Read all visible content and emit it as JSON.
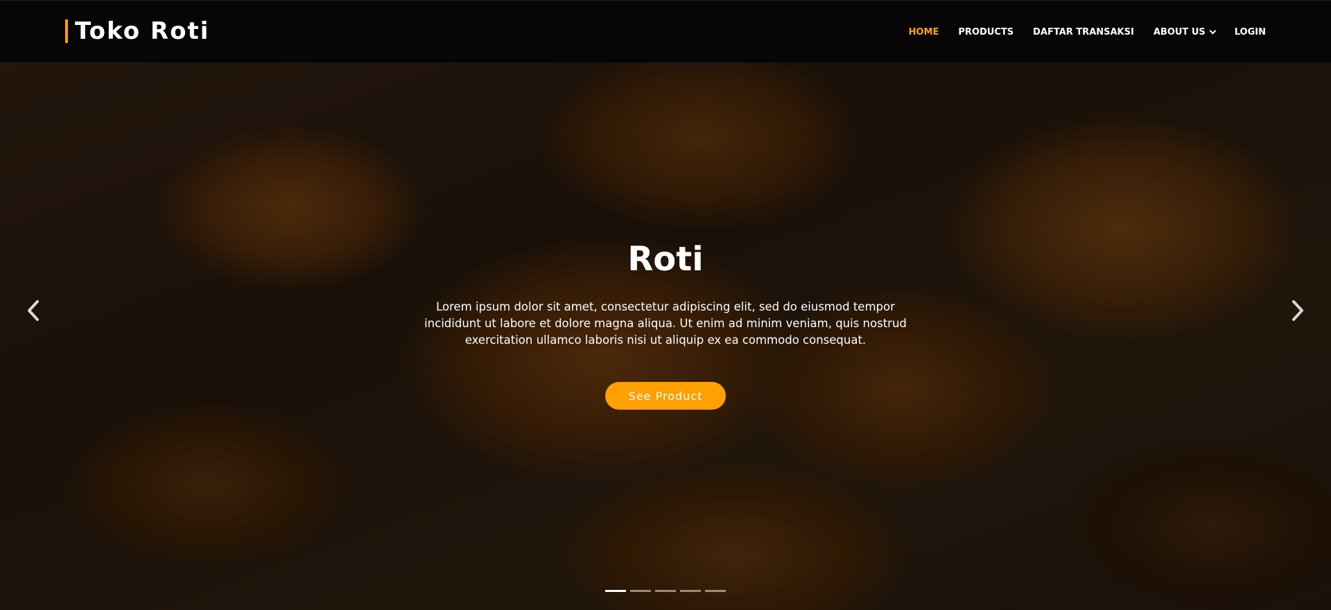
{
  "brand": {
    "name": "Toko Roti",
    "accent_color": "#ff9f00"
  },
  "nav": {
    "items": [
      {
        "label": "HOME",
        "active": true
      },
      {
        "label": "PRODUCTS",
        "active": false
      },
      {
        "label": "DAFTAR TRANSAKSI",
        "active": false
      },
      {
        "label": "ABOUT US",
        "active": false,
        "has_dropdown": true
      },
      {
        "label": "LOGIN",
        "active": false
      }
    ],
    "active_color": "#ffa31a"
  },
  "hero": {
    "background": "croissants in a basket",
    "title": "Roti",
    "description": "Lorem ipsum dolor sit amet, consectetur adipiscing elit, sed do eiusmod tempor incididunt ut labore et dolore magna aliqua. Ut enim ad minim veniam, quis nostrud exercitation ullamco laboris nisi ut aliquip ex ea commodo consequat.",
    "cta_label": "See Product",
    "cta_color": "#ffa000",
    "prev_icon": "chevron-left-icon",
    "next_icon": "chevron-right-icon",
    "slides_total": 5,
    "active_slide": 1
  }
}
